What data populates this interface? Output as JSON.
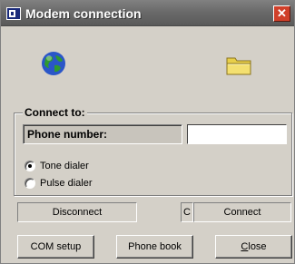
{
  "window": {
    "title": "Modem connection",
    "close_glyph": "✕"
  },
  "connect_group": {
    "title": "Connect to:",
    "phone_label": "Phone number:",
    "phone_value": "",
    "radio_tone": "Tone dialer",
    "radio_pulse": "Pulse dialer",
    "selected": "Tone dialer"
  },
  "buttons": {
    "disconnect": "Disconnect",
    "c_small": "C",
    "connect": "Connect",
    "com_setup": "COM setup",
    "phone_book": "Phone book",
    "close": "Close"
  },
  "icons": {
    "app": "modem-app-icon",
    "globe": "globe-icon",
    "folder": "folder-icon"
  },
  "colors": {
    "titlebar": "#6a6a6a",
    "close_button": "#d0402a",
    "dialog_face": "#d4d0c8"
  }
}
